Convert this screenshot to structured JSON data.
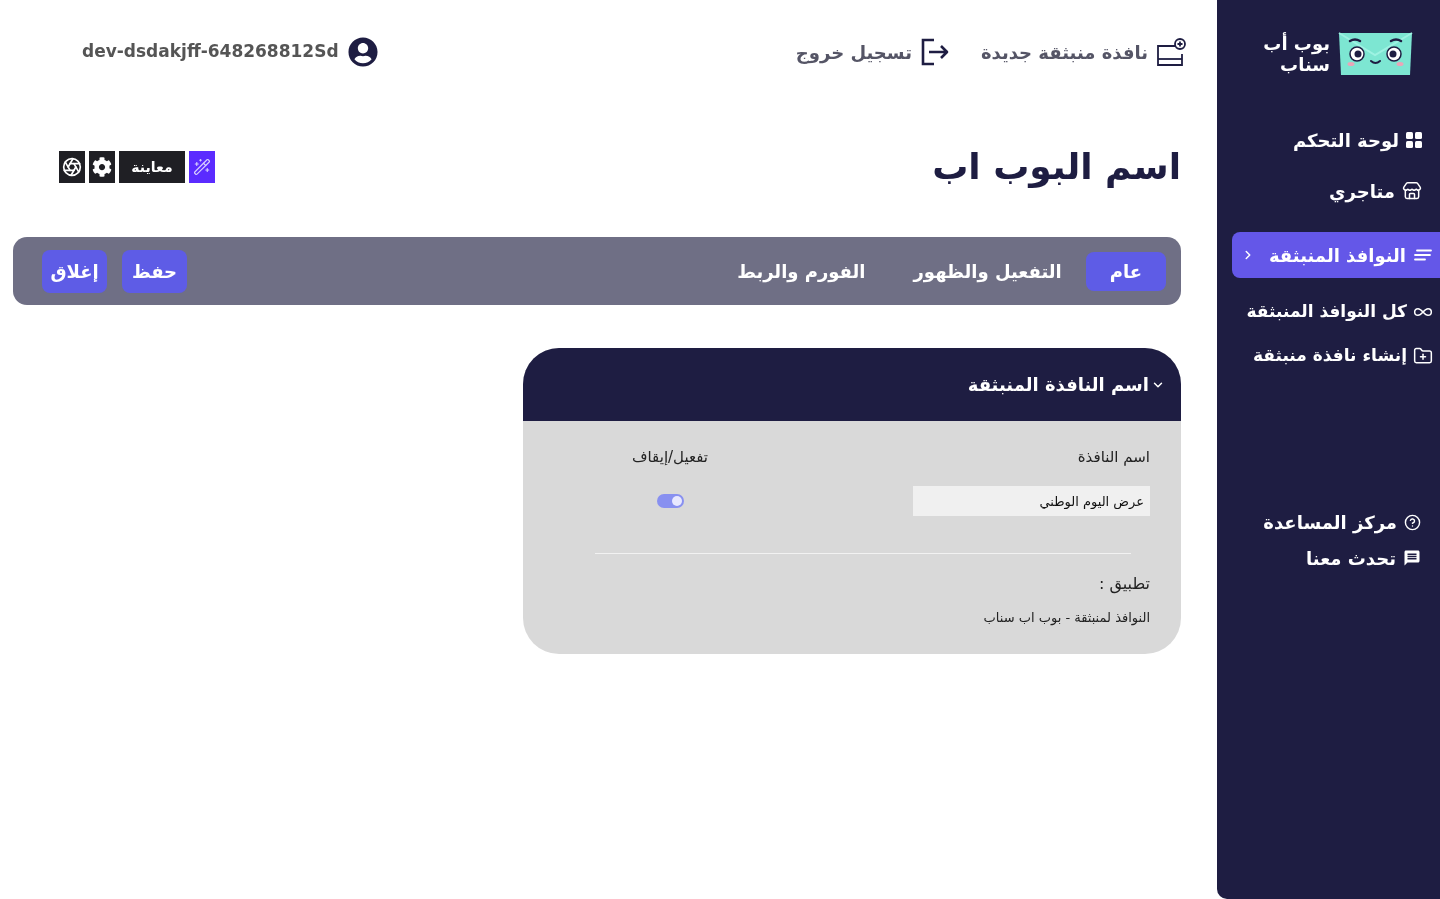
{
  "sidebar": {
    "logo": {
      "line_1": "بوب أب",
      "line_2": "سناب"
    },
    "nav": [
      {
        "label": "لوحة التحكم",
        "selected": false
      },
      {
        "label": "متاجري",
        "selected": false
      },
      {
        "label": "النوافذ المنبثقة",
        "selected": true,
        "children": [
          {
            "label": "كل النوافذ المنبثقة",
            "selected": false
          },
          {
            "label": "إنشاء نافذة منبثقة",
            "selected": false
          }
        ]
      }
    ],
    "footer_links": [
      {
        "label": "مركز المساعدة"
      },
      {
        "label": "تحدث معنا"
      }
    ]
  },
  "top_bar": {
    "links": [
      {
        "label": "نافذة منبثقة جديدة"
      },
      {
        "label": "تسجيل خروج"
      }
    ],
    "user": "dev-dsdakjff-648268812Sd"
  },
  "page": {
    "title": "اسم البوب اب",
    "toolbar": {
      "preview_label": "معاينة"
    }
  },
  "tabs": [
    {
      "label": "عام",
      "selected": true
    },
    {
      "label": "التفعيل والظهور",
      "selected": false
    },
    {
      "label": "الفورم والربط",
      "selected": false
    }
  ],
  "actions": [
    {
      "label": "حفظ"
    },
    {
      "label": "إغلاق"
    }
  ],
  "card": {
    "title": "اسم النافذة المنبثقة",
    "expanded": true,
    "name_field": {
      "label": "اسم النافذة",
      "value": "عرض اليوم الوطني"
    },
    "toggle": {
      "label": "تفعيل/إيقاف",
      "on": true
    },
    "app": {
      "label": "تطبيق :",
      "value": "النوافذ لمنبثقة - بوب اب سناب"
    }
  }
}
